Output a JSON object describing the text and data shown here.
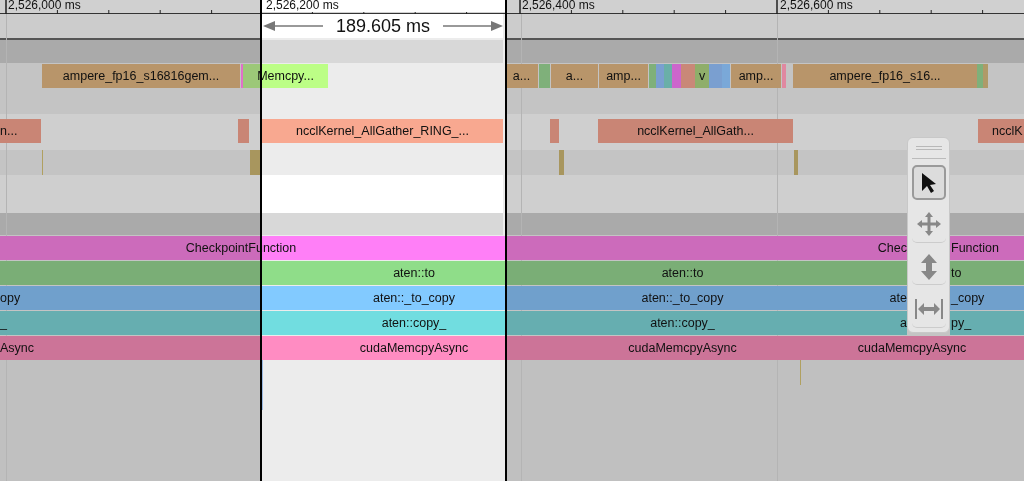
{
  "ruler": {
    "labels": [
      "2,526,000 ms",
      "2,526,200 ms",
      "2,526,400 ms",
      "2,526,600 ms"
    ]
  },
  "selection": {
    "duration": "189.605 ms"
  },
  "rows": [
    {
      "kind": "slices",
      "slices": [
        {
          "label": "ampere_fp16_s16816gem...",
          "color": "#b8956a"
        },
        {
          "color": "#e070c8"
        },
        {
          "label": "Memcpy...",
          "color": "#9cc878"
        },
        {
          "label": "a...",
          "color": "#b8956a"
        },
        {
          "color": "#7fb07a"
        },
        {
          "label": "a...",
          "color": "#b8956a"
        },
        {
          "label": "amp...",
          "color": "#b8956a"
        },
        {
          "color": "#7fb07a"
        },
        {
          "color": "#7a9fd0"
        },
        {
          "color": "#6aafa8"
        },
        {
          "color": "#cc66cc"
        },
        {
          "color": "#c98878"
        },
        {
          "label": "v",
          "color": "#8fae6a"
        },
        {
          "color": "#7a9fd0"
        },
        {
          "color": "#7aa8d8"
        },
        {
          "label": "amp...",
          "color": "#b8956a"
        },
        {
          "color": "#e088a0"
        },
        {
          "label": "ampere_fp16_s16...",
          "color": "#b8956a"
        },
        {
          "color": "#7fb07a"
        },
        {
          "color": "#b09a68"
        }
      ]
    },
    {
      "kind": "slices",
      "slices": [
        {
          "label": "n...",
          "color": "#c98575"
        },
        {
          "color": "#c98575"
        },
        {
          "label": "ncclKernel_AllGather_RING_...",
          "color": "#f8a890"
        },
        {
          "color": "#c98575"
        },
        {
          "label": "ncclKernel_AllGath...",
          "color": "#c98575"
        },
        {
          "label": "ncclK",
          "color": "#c98575"
        }
      ]
    },
    {
      "kind": "marks",
      "slices": [
        {
          "color": "#b0a060"
        },
        {
          "color": "#a8965e"
        },
        {
          "color": "#a8965e"
        },
        {
          "color": "#a8965e"
        }
      ]
    },
    {
      "kind": "slices",
      "slices": [
        {
          "label": "CheckpointFunction",
          "color": "#cc6bbb"
        },
        {
          "label": "Chec",
          "label_after": "Function",
          "color": "#cc6bbb"
        }
      ]
    },
    {
      "kind": "slices",
      "slices": [
        {
          "color": "#7aae76"
        },
        {
          "label": "aten::to",
          "color": "#7aae76"
        },
        {
          "label": "aten::to",
          "color": "#7aae76"
        },
        {
          "label_after": "to",
          "color": "#7aae76"
        }
      ]
    },
    {
      "kind": "slices",
      "slices": [
        {
          "label": "opy",
          "color": "#70a0cc"
        },
        {
          "label": "aten::_to_copy",
          "color": "#70a0cc"
        },
        {
          "label": "aten::_to_copy",
          "color": "#70a0cc"
        },
        {
          "label": "ate",
          "label_after": "_copy",
          "color": "#70a0cc"
        }
      ]
    },
    {
      "kind": "slices",
      "slices": [
        {
          "label": "_",
          "color": "#66aeb0"
        },
        {
          "label": "aten::copy_",
          "color": "#66aeb0"
        },
        {
          "label": "aten::copy_",
          "color": "#66aeb0"
        },
        {
          "label": "a",
          "label_after": "py_",
          "color": "#66aeb0"
        }
      ]
    },
    {
      "kind": "slices",
      "slices": [
        {
          "label": "Async",
          "color": "#cc7498"
        },
        {
          "label": "cudaMemcpyAsync",
          "color": "#cc7498"
        },
        {
          "label": "cudaMemcpyAsync",
          "color": "#cc7498"
        },
        {
          "label": "cudaMemcpyAsync",
          "color": "#cc7498"
        }
      ]
    },
    {
      "kind": "marks",
      "slices": [
        {
          "color": "#9ab8e0"
        },
        {
          "color": "#b0a060"
        }
      ]
    }
  ],
  "tools": [
    {
      "kind": "select",
      "selected": true
    },
    {
      "kind": "pan",
      "selected": false
    },
    {
      "kind": "zoom",
      "selected": false
    },
    {
      "kind": "timing",
      "selected": false
    }
  ]
}
